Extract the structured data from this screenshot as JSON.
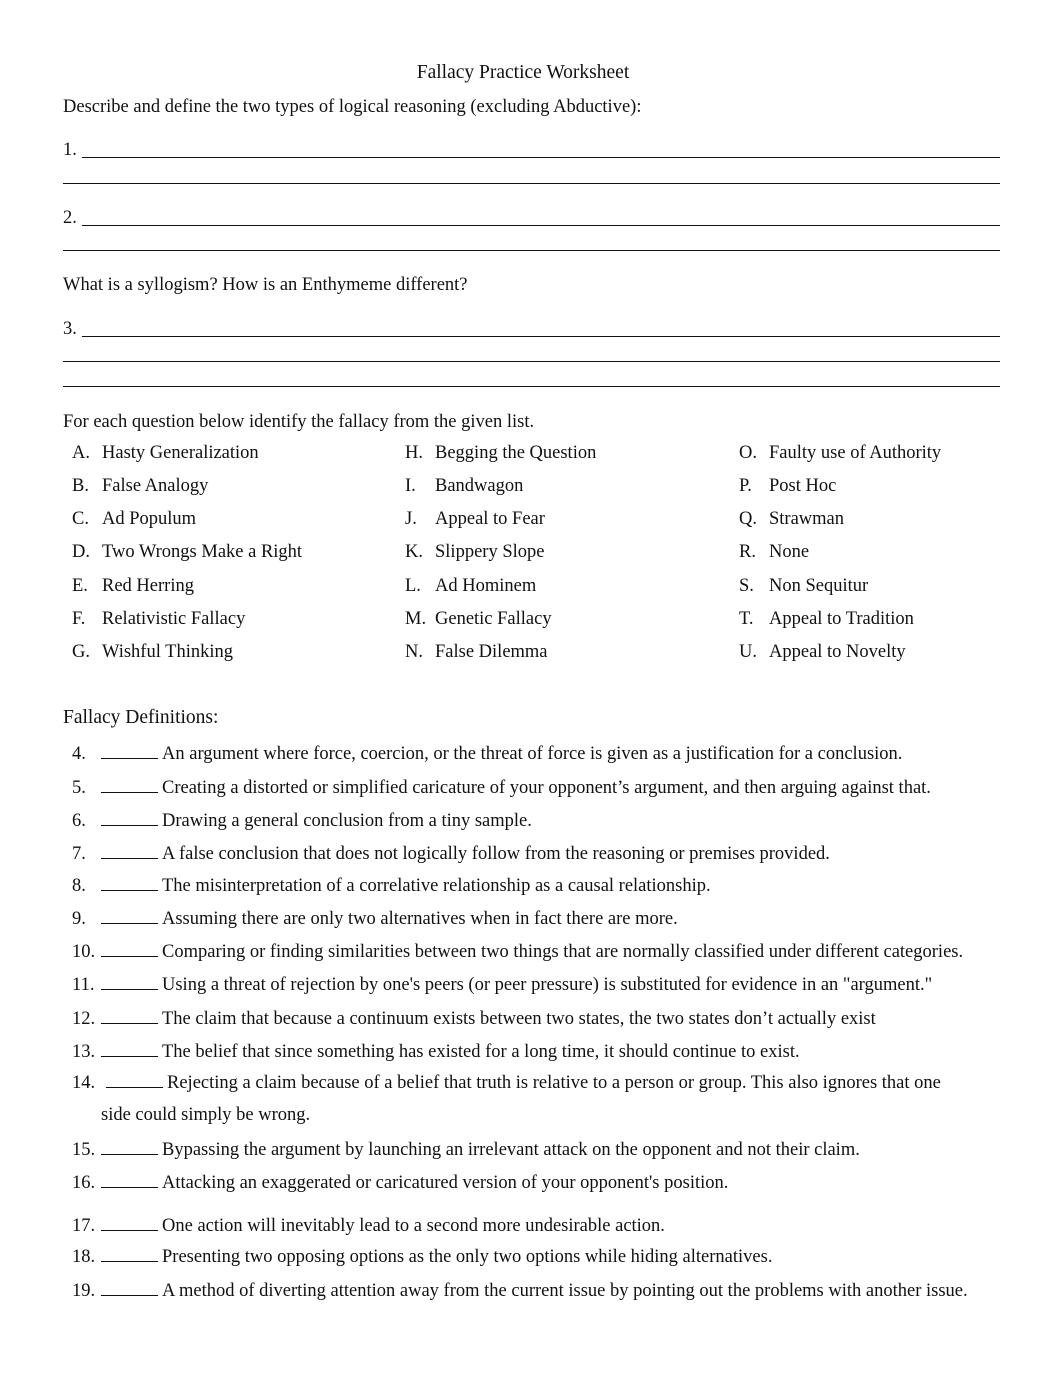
{
  "title": "Fallacy Practice Worksheet",
  "section1": {
    "prompt": "Describe  and define  the two types of logical reasoning (excluding Abductive):",
    "answers": [
      {
        "label": "1.",
        "value": ""
      },
      {
        "label": "2.",
        "value": ""
      }
    ]
  },
  "section2": {
    "prompt": "What is a syllogism? How is an Enthymeme   different?",
    "answers": [
      {
        "label": "3.",
        "value": ""
      }
    ]
  },
  "fallacy_list": {
    "instruction": "For each question below identify the fallacy from the given list.",
    "columns": [
      [
        {
          "letter": "A.",
          "name": "Hasty Generalization"
        },
        {
          "letter": "B.",
          "name": "False Analogy"
        },
        {
          "letter": "C.",
          "name": "Ad Populum"
        },
        {
          "letter": "D.",
          "name": "Two Wrongs Make a Right"
        },
        {
          "letter": "E.",
          "name": "Red Herring"
        },
        {
          "letter": "F.",
          "name": "Relativistic Fallacy"
        },
        {
          "letter": "G.",
          "name": "Wishful Thinking"
        }
      ],
      [
        {
          "letter": "H.",
          "name": "Begging the Question"
        },
        {
          "letter": "I.",
          "name": "Bandwagon"
        },
        {
          "letter": "J.",
          "name": "Appeal to Fear"
        },
        {
          "letter": "K.",
          "name": "Slippery Slope"
        },
        {
          "letter": "L.",
          "name": "Ad Hominem"
        },
        {
          "letter": "M.",
          "name": "Genetic Fallacy"
        },
        {
          "letter": "N.",
          "name": "False Dilemma"
        }
      ],
      [
        {
          "letter": "O.",
          "name": "Faulty use of Authority"
        },
        {
          "letter": "P.",
          "name": "Post Hoc"
        },
        {
          "letter": "Q.",
          "name": "Strawman"
        },
        {
          "letter": "R.",
          "name": "None"
        },
        {
          "letter": "S.",
          "name": "Non Sequitur"
        },
        {
          "letter": "T.",
          "name": "Appeal to Tradition"
        },
        {
          "letter": "U.",
          "name": "Appeal to Novelty"
        }
      ]
    ]
  },
  "definitions": {
    "heading": "Fallacy Definitions:",
    "items": [
      {
        "num": "4.",
        "answer": "",
        "text": "An argument where force, coercion, or the threat of force is given as a justification for a conclusion."
      },
      {
        "num": "5.",
        "answer": "",
        "text": "Creating a distorted or simplified caricature of your opponent’s argument, and then arguing against that."
      },
      {
        "num": "6.",
        "answer": "",
        "text": "Drawing a general conclusion from a tiny sample."
      },
      {
        "num": "7.",
        "answer": "",
        "text": "A false conclusion that does not logically follow from the reasoning or premises provided."
      },
      {
        "num": "8.",
        "answer": "",
        "text": "The misinterpretation of a correlative relationship as a causal relationship."
      },
      {
        "num": "9.",
        "answer": "",
        "text": "Assuming there are only two alternatives when in fact there are more."
      },
      {
        "num": "10.",
        "answer": "",
        "text": "Comparing or finding similarities between two things that are normally classified under different categories."
      },
      {
        "num": "11.",
        "answer": "",
        "text": "Using a threat of rejection by one's peers (or peer pressure) is substituted for evidence in an \"argument.\""
      },
      {
        "num": "12.",
        "answer": "",
        "text": "The claim that because a continuum exists between two states, the two states don’t actually exist"
      },
      {
        "num": "13.",
        "answer": "",
        "text": "The belief that since something has existed for a long time, it should continue to exist."
      },
      {
        "num": "14.",
        "answer": "",
        "text": "Rejecting a claim because of a belief that truth is relative to a person or group. This also ignores that one",
        "continuation": "side could simply be wrong."
      },
      {
        "num": "15.",
        "answer": "",
        "text": "Bypassing the argument by launching an irrelevant attack on the opponent and not their claim."
      },
      {
        "num": "16.",
        "answer": "",
        "text": "Attacking an exaggerated or caricatured version of your opponent's position."
      },
      {
        "num": "17.",
        "answer": "",
        "text": "One action will inevitably lead to a second more undesirable action."
      },
      {
        "num": "18.",
        "answer": "",
        "text": "Presenting two opposing options as the only two options while hiding alternatives."
      },
      {
        "num": "19.",
        "answer": "",
        "text": "A method of diverting attention away from the current issue by pointing out the problems with another issue."
      }
    ]
  }
}
